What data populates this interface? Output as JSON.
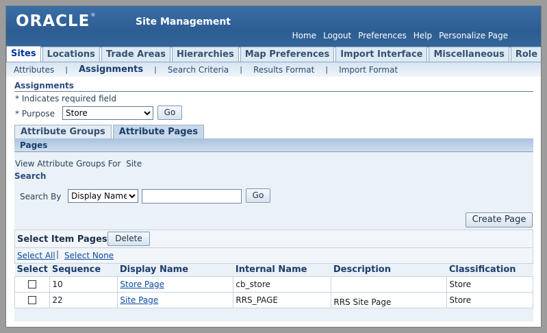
{
  "header": {
    "logo": "ORACLE",
    "title": "Site Management",
    "global_links": [
      "Home",
      "Logout",
      "Preferences",
      "Help",
      "Personalize Page"
    ]
  },
  "tabs": [
    "Sites",
    "Locations",
    "Trade Areas",
    "Hierarchies",
    "Map Preferences",
    "Import Interface",
    "Miscellaneous",
    "Role Security"
  ],
  "active_tab": "Sites",
  "subnav": [
    "Attributes",
    "Assignments",
    "Search Criteria",
    "Results Format",
    "Import Format"
  ],
  "active_subnav": "Assignments",
  "section_title": "Assignments",
  "required_note": "* Indicates required field",
  "purpose": {
    "label": "* Purpose",
    "value": "Store",
    "go_label": "Go"
  },
  "subtabs": [
    "Attribute Groups",
    "Attribute Pages"
  ],
  "active_subtab": "Attribute Pages",
  "pages_header": "Pages",
  "view_for": {
    "label": "View Attribute Groups For",
    "value": "Site"
  },
  "search": {
    "title": "Search",
    "by_label": "Search By",
    "by_value": "Display Name",
    "input_value": "",
    "go_label": "Go"
  },
  "create_page_label": "Create Page",
  "select_item_pages_label": "Select Item Pages:",
  "delete_label": "Delete",
  "select_all": "Select All",
  "select_none": "Select None",
  "columns": [
    "Select",
    "Sequence",
    "Display Name",
    "Internal Name",
    "Description",
    "Classification"
  ],
  "rows": [
    {
      "sequence": "10",
      "display_name": "Store Page",
      "internal_name": "cb_store",
      "description": "",
      "classification": "Store"
    },
    {
      "sequence": "22",
      "display_name": "Site Page",
      "internal_name": "RRS_PAGE",
      "description": "RRS Site Page",
      "classification": "Store"
    }
  ],
  "colors": {
    "header_blue": "#336699",
    "link": "#0b4ba0",
    "accent_bar": "#a8c3de"
  }
}
